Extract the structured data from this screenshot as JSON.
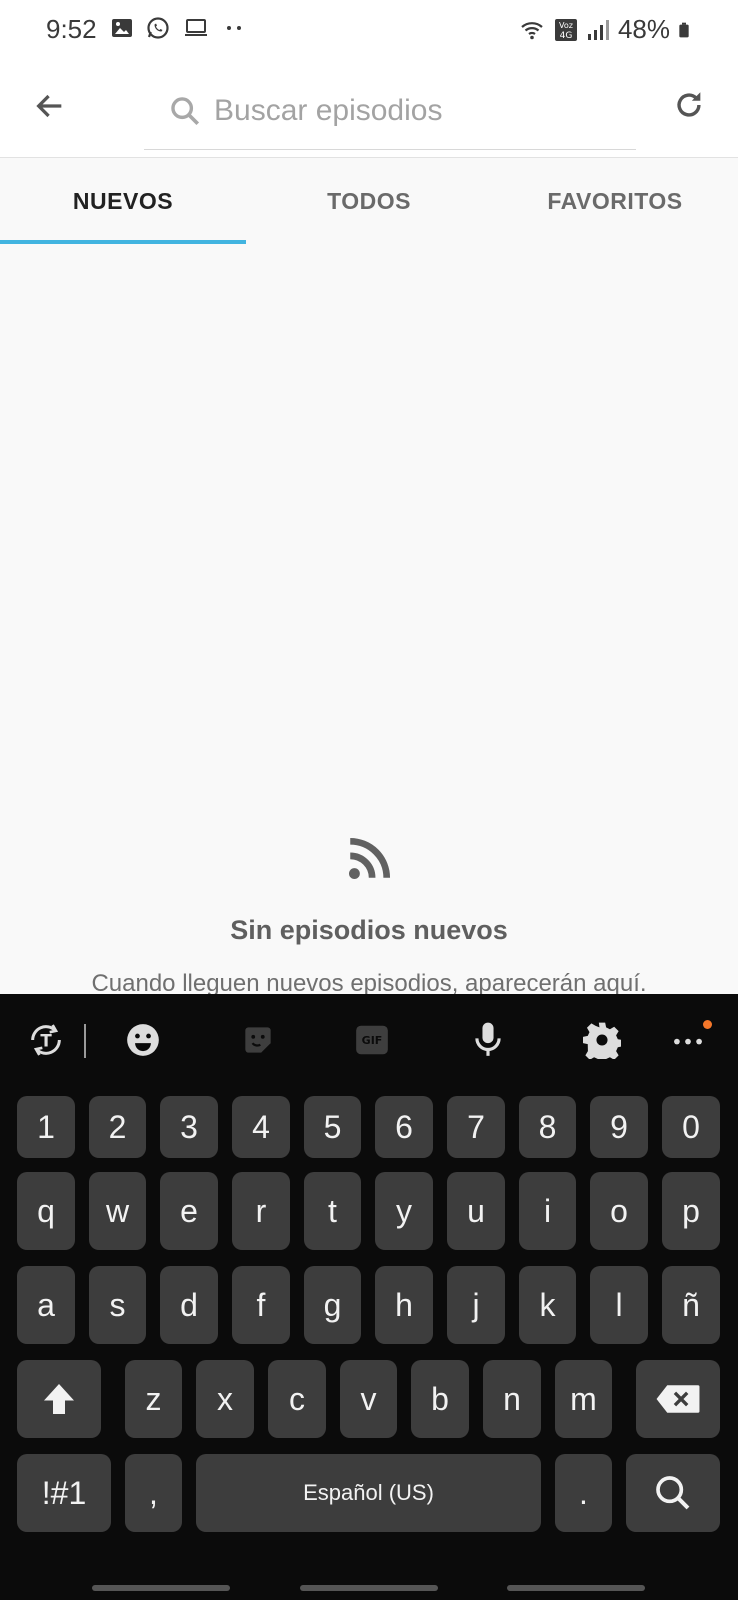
{
  "status_bar": {
    "time": "9:52",
    "battery": "48%",
    "icons": [
      "image-icon",
      "whatsapp-icon",
      "laptop-icon",
      "more-dots-icon",
      "wifi-icon",
      "volte-4g-icon",
      "signal-icon",
      "battery-icon"
    ]
  },
  "app_bar": {
    "search_placeholder": "Buscar episodios",
    "icons": [
      "back-arrow-icon",
      "search-icon",
      "refresh-icon"
    ]
  },
  "tabs": [
    {
      "label": "NUEVOS",
      "active": true
    },
    {
      "label": "TODOS",
      "active": false
    },
    {
      "label": "FAVORITOS",
      "active": false
    }
  ],
  "accent_color": "#42b4e0",
  "empty_state": {
    "icon": "rss-icon",
    "title": "Sin episodios nuevos",
    "description": "Cuando lleguen nuevos episodios, aparecerán aquí."
  },
  "keyboard": {
    "toolbar_icons": [
      "translate-icon",
      "emoji-icon",
      "sticker-icon",
      "gif-icon",
      "microphone-icon",
      "settings-icon",
      "more-options-icon"
    ],
    "gif_label": "GIF",
    "number_row": [
      "1",
      "2",
      "3",
      "4",
      "5",
      "6",
      "7",
      "8",
      "9",
      "0"
    ],
    "row1": [
      "q",
      "w",
      "e",
      "r",
      "t",
      "y",
      "u",
      "i",
      "o",
      "p"
    ],
    "row2": [
      "a",
      "s",
      "d",
      "f",
      "g",
      "h",
      "j",
      "k",
      "l",
      "ñ"
    ],
    "row3": [
      "z",
      "x",
      "c",
      "v",
      "b",
      "n",
      "m"
    ],
    "symbols_key": "!#1",
    "comma_key": ",",
    "space_label": "Español (US)",
    "period_key": ".",
    "action_icons": [
      "shift-icon",
      "backspace-icon",
      "search-icon"
    ]
  }
}
